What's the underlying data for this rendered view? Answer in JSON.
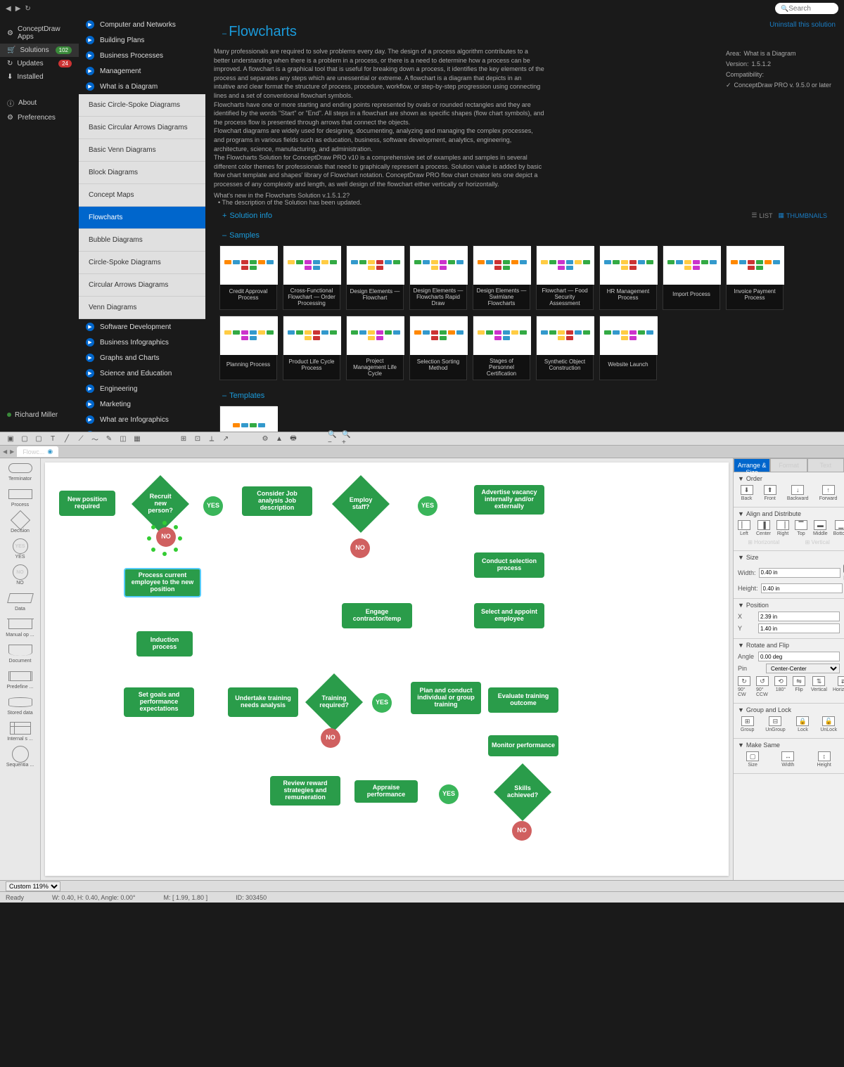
{
  "search_placeholder": "Search",
  "uninstall_link": "Uninstall this solution",
  "left_nav": [
    {
      "label": "ConceptDraw Apps",
      "icon": "⚙"
    },
    {
      "label": "Solutions",
      "icon": "🛒",
      "badge": "102",
      "badge_class": "green",
      "selected": true
    },
    {
      "label": "Updates",
      "icon": "↻",
      "badge": "24",
      "badge_class": "red"
    },
    {
      "label": "Installed",
      "icon": "⬇"
    }
  ],
  "left_nav_bottom": [
    {
      "label": "About",
      "icon": "ⓘ"
    },
    {
      "label": "Preferences",
      "icon": "⚙"
    }
  ],
  "user_name": "Richard Miller",
  "categories_top": [
    "Computer and Networks",
    "Building Plans",
    "Business Processes",
    "Management",
    "What is a Diagram"
  ],
  "sub_categories": [
    "Basic Circle-Spoke Diagrams",
    "Basic Circular Arrows Diagrams",
    "Basic Venn Diagrams",
    "Block Diagrams",
    "Concept Maps",
    "Flowcharts",
    "Bubble Diagrams",
    "Circle-Spoke Diagrams",
    "Circular Arrows Diagrams",
    "Venn Diagrams"
  ],
  "sub_active": "Flowcharts",
  "categories_bottom": [
    "Software Development",
    "Business Infographics",
    "Graphs and Charts",
    "Science and Education",
    "Engineering",
    "Marketing",
    "What are Infographics",
    "Illustrations"
  ],
  "page_title": "Flowcharts",
  "description": "Many professionals are required to solve problems every day. The design of a process algorithm contributes to a better understanding when there is a problem in a process, or there is a need to determine how a process can be improved. A flowchart is a graphical tool that is useful for breaking down a process, it identifies the key elements of the process and separates any steps which are unessential or extreme. A flowchart is a diagram that depicts in an intuitive and clear format the structure of process, procedure, workflow, or step-by-step progression using connecting lines and a set of conventional flowchart symbols.\nFlowcharts have one or more starting and ending points represented by ovals or rounded rectangles and they are identified by the words \"Start\" or \"End\". All steps in a flowchart are shown as specific shapes (flow chart symbols), and the process flow is presented through arrows that connect the objects.\nFlowchart diagrams are widely used for designing, documenting, analyzing and managing the complex processes, and programs in various fields such as education, business, software development, analytics, engineering, architecture, science, manufacturing, and administration.\nThe Flowcharts Solution for ConceptDraw PRO v10 is a comprehensive set of examples and samples in several different color themes for professionals that need to graphically represent a process. Solution value is added by basic flow chart template and shapes' library of Flowchart notation. ConceptDraw PRO flow chart creator lets one depict a processes of any complexity and length, as well design of the flowchart either vertically or horizontally.",
  "whats_new_title": "What's new in the  Flowcharts Solution v.1.5.1.2?",
  "whats_new_item": "• The description of the Solution has been updated.",
  "info": {
    "area_label": "Area:",
    "area": "What is a Diagram",
    "version_label": "Version:",
    "version": "1.5.1.2",
    "compat_label": "Compatibility:",
    "compat": "ConceptDraw PRO v. 9.5.0 or later"
  },
  "section_info": "Solution info",
  "section_samples": "Samples",
  "section_templates": "Templates",
  "view_list": "LIST",
  "view_thumb": "THUMBNAILS",
  "samples": [
    "Credit Approval Process",
    "Cross-Functional Flowchart — Order Processing",
    "Design Elements — Flowchart",
    "Design Elements — Flowcharts Rapid Draw",
    "Design Elements — Swimlane Flowcharts",
    "Flowchart — Food Security Assessment",
    "HR Management Process",
    "Import Process",
    "Invoice Payment Process",
    "Planning Process",
    "Product Life Cycle Process",
    "Project Management Life Cycle",
    "Selection Sorting Method",
    "Stages of Personnel Certification",
    "Synthetic Object Construction",
    "Website Launch"
  ],
  "palette": [
    {
      "label": "Terminator",
      "type": "terminator"
    },
    {
      "label": "Process",
      "type": "process"
    },
    {
      "label": "Decision",
      "type": "decision"
    },
    {
      "label": "YES",
      "type": "yes"
    },
    {
      "label": "NO",
      "type": "no"
    },
    {
      "label": "Data",
      "type": "data"
    },
    {
      "label": "Manual op ...",
      "type": "manualop"
    },
    {
      "label": "Document",
      "type": "document"
    },
    {
      "label": "Predefine ...",
      "type": "predefined"
    },
    {
      "label": "Stored data",
      "type": "stored"
    },
    {
      "label": "Internal s ...",
      "type": "internal"
    },
    {
      "label": "Sequentia ...",
      "type": "sequential"
    }
  ],
  "props_tabs": [
    "Arrange & Size",
    "Format",
    "Text"
  ],
  "props": {
    "order": "Order",
    "order_items": [
      "Back",
      "Front",
      "Backward",
      "Forward"
    ],
    "align": "Align and Distribute",
    "align_items": [
      "Left",
      "Center",
      "Right",
      "Top",
      "Middle",
      "Bottom"
    ],
    "align_h": "Horizontal",
    "align_v": "Vertical",
    "size": "Size",
    "width": "Width:",
    "width_v": "0.40 in",
    "height": "Height:",
    "height_v": "0.40 in",
    "lock": "Lock Proportions",
    "position": "Position",
    "x": "X",
    "x_v": "2.39 in",
    "y": "Y",
    "y_v": "1.40 in",
    "rotate": "Rotate and Flip",
    "angle": "Angle",
    "angle_v": "0.00 deg",
    "pin": "Pin",
    "pin_v": "Center-Center",
    "rotate_items": [
      "90° CW",
      "90° CCW",
      "180°",
      "Flip",
      "Vertical",
      "Horizontal"
    ],
    "group": "Group and Lock",
    "group_items": [
      "Group",
      "UnGroup",
      "Lock",
      "UnLock"
    ],
    "make": "Make Same",
    "make_items": [
      "Size",
      "Width",
      "Height"
    ]
  },
  "doc_tab": "Flowc...",
  "zoom": "Custom 119%",
  "status": {
    "ready": "Ready",
    "dim": "W: 0.40,  H: 0.40,  Angle: 0.00°",
    "mouse": "M: [ 1.99, 1.80 ]",
    "id": "ID: 303450"
  },
  "flow": {
    "n1": "New position required",
    "n2": "Recruit new person?",
    "yes": "YES",
    "no": "NO",
    "n3": "Consider Job analysis Job description",
    "n4": "Employ staff?",
    "n5": "Advertise vacancy internally and/or externally",
    "n6": "Conduct selection process",
    "n7": "Process current employee to the new position",
    "n8": "Induction process",
    "n9": "Engage contractor/temp",
    "n10": "Select and appoint employee",
    "n11": "Set goals and performance expectations",
    "n12": "Undertake training needs analysis",
    "n13": "Training required?",
    "n14": "Plan and conduct individual or group training",
    "n15": "Evaluate training outcome",
    "n16": "Monitor performance",
    "n17": "Skills achieved?",
    "n18": "Appraise performance",
    "n19": "Review reward strategies and remuneration"
  }
}
